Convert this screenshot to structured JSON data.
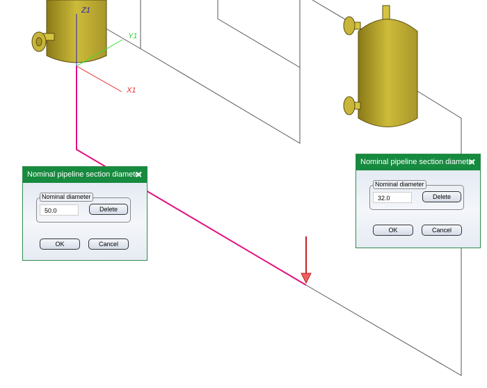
{
  "axes": {
    "z": "Z1",
    "y": "Y1",
    "x": "X1"
  },
  "dialogs": [
    {
      "title": "Nominal pipeline section diameter",
      "group_label": "Nominal diameter",
      "value": "50.0",
      "delete": "Delete",
      "ok": "OK",
      "cancel": "Cancel",
      "close": "✕"
    },
    {
      "title": "Nominal pipeline section diameter",
      "group_label": "Nominal diameter",
      "value": "32.0",
      "delete": "Delete",
      "ok": "OK",
      "cancel": "Cancel",
      "close": "✕"
    }
  ],
  "colors": {
    "pipe": "#e0107f",
    "vessel": "#c8b432",
    "dialog_title": "#168a3e"
  }
}
